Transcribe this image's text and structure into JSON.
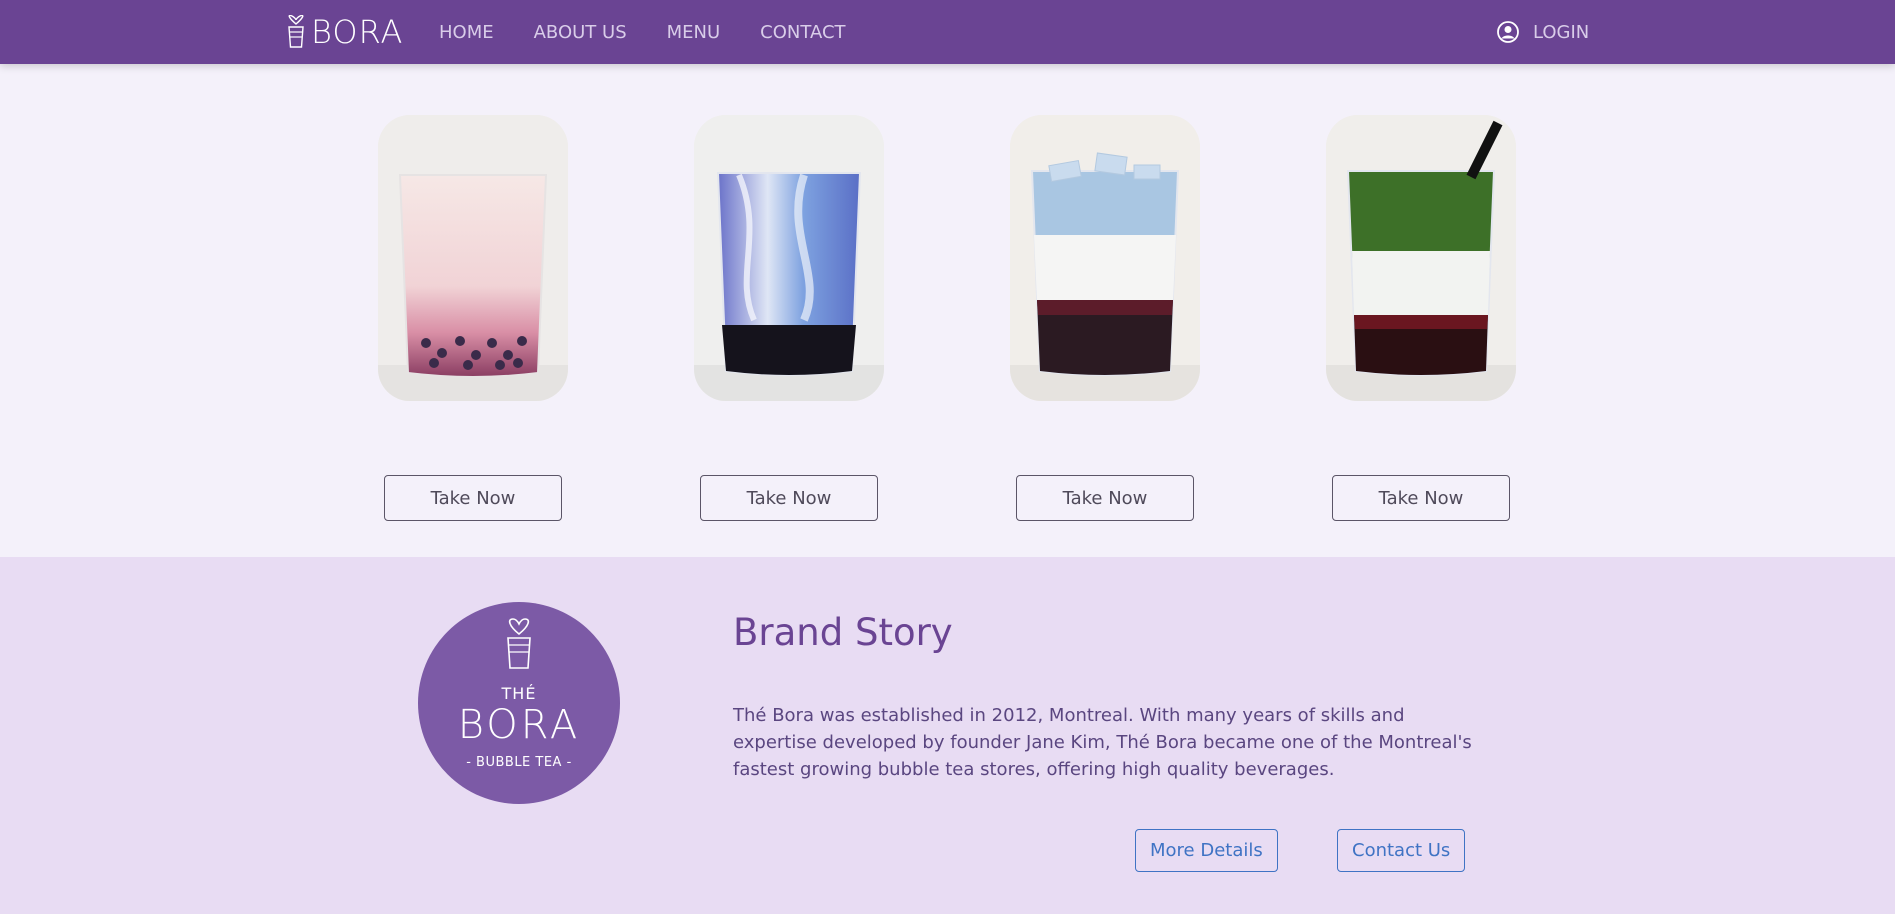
{
  "nav": {
    "brand": "BORA",
    "links": [
      "HOME",
      "ABOUT US",
      "MENU",
      "CONTACT"
    ],
    "login": "LOGIN",
    "color": "#6a4493"
  },
  "products": [
    {
      "name": "pink-bubble-tea",
      "button": "Take Now"
    },
    {
      "name": "blue-milk-tea",
      "button": "Take Now"
    },
    {
      "name": "butterfly-pea-tea",
      "button": "Take Now"
    },
    {
      "name": "matcha-latte",
      "button": "Take Now"
    }
  ],
  "story": {
    "logo": {
      "top": "THÉ",
      "brand": "BORA",
      "sub": "- BUBBLE TEA -"
    },
    "title": "Brand Story",
    "text": "Thé Bora was established in 2012, Montreal. With many years of skills and expertise developed by founder Jane Kim, Thé Bora became one of the Montreal's fastest growing bubble tea stores, offering high quality beverages.",
    "buttons": {
      "more": "More Details",
      "contact": "Contact Us"
    },
    "accent": "#3f73c4"
  }
}
